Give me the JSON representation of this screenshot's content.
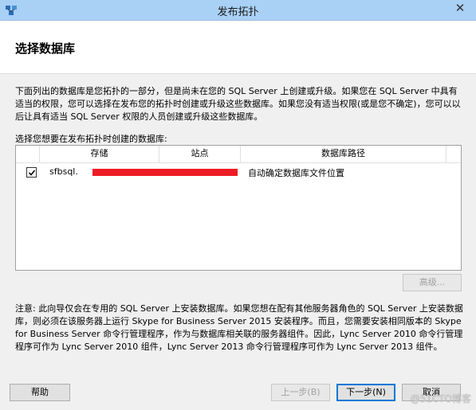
{
  "window": {
    "title": "发布拓扑",
    "close_glyph": "✕"
  },
  "header": {
    "title": "选择数据库"
  },
  "description": "下面列出的数据库是您拓扑的一部分，但是尚未在您的 SQL Server 上创建或升级。如果您在 SQL Server 中具有适当的权限，您可以选择在发布您的拓扑时创建或升级这些数据库。如果您没有适当权限(或是您不确定)，您可以以后让具有适当 SQL Server 权限的人员创建或升级这些数据库。",
  "list": {
    "label": "选择您想要在发布拓扑时创建的数据库:",
    "columns": [
      "存储",
      "站点",
      "数据库路径"
    ],
    "rows": [
      {
        "checked": true,
        "store": "sfbsql.",
        "site": "",
        "path": "自动确定数据库文件位置"
      }
    ]
  },
  "buttons": {
    "advanced": "高级...",
    "help": "帮助",
    "back": "上一步(B)",
    "next": "下一步(N)",
    "cancel": "取消"
  },
  "note": "注意: 此向导仅会在专用的 SQL Server 上安装数据库。如果您想在配有其他服务器角色的 SQL Server 上安装数据库，则必须在该服务器上运行 Skype for Business Server 2015 安装程序。而且，您需要安装相同版本的 Skype for Business Server 命令行管理程序，作为与数据库相关联的服务器组件。因此，Lync Server 2010 命令行管理程序可作为 Lync Server 2010 组件，Lync Server 2013 命令行管理程序可作为 Lync Server 2013 组件。",
  "watermark": "@51CTO博客",
  "colors": {
    "titlebar": "#a9d0f5",
    "redaction": "#ee1c25"
  }
}
